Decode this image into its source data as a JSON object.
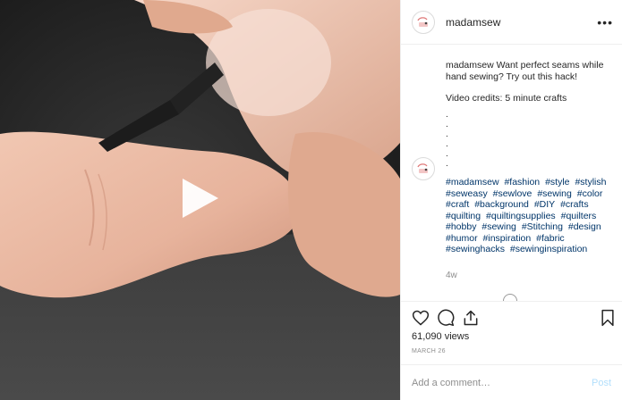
{
  "post": {
    "username": "madamsew",
    "more_icon": "ellipsis-icon",
    "caption_user": "madamsew",
    "caption_text": "Want perfect seams while hand sewing? Try out this hack!",
    "credits": "Video credits: 5 minute crafts",
    "dots": [
      ".",
      ".",
      ".",
      ".",
      ".",
      "."
    ],
    "hashtags": [
      "#madamsew",
      "#fashion",
      "#style",
      "#stylish",
      "#seweasy",
      "#sewlove",
      "#sewing",
      "#color",
      "#craft",
      "#background",
      "#DIY",
      "#crafts",
      "#quilting",
      "#quiltingsupplies",
      "#quilters",
      "#hobby",
      "#sewing",
      "#Stitching",
      "#design",
      "#humor",
      "#inspiration",
      "#fabric",
      "#sewinghacks",
      "#sewinginspiration"
    ],
    "time_ago": "4w",
    "views": "61,090 views",
    "date": "MARCH 26",
    "comment_placeholder": "Add a comment…",
    "post_button": "Post"
  }
}
